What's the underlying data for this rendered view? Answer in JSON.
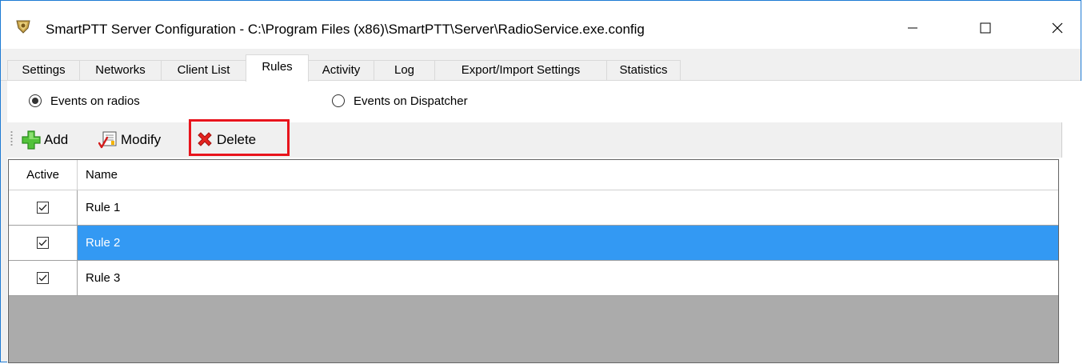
{
  "window": {
    "title": "SmartPTT Server Configuration - C:\\Program Files (x86)\\SmartPTT\\Server\\RadioService.exe.config",
    "controls": {
      "minimize": "—",
      "maximize": "☐",
      "close": "✕"
    }
  },
  "tabs": [
    {
      "label": "Settings",
      "active": false
    },
    {
      "label": "Networks",
      "active": false
    },
    {
      "label": "Client List",
      "active": false
    },
    {
      "label": "Rules",
      "active": true
    },
    {
      "label": "Activity",
      "active": false
    },
    {
      "label": "Log",
      "active": false
    },
    {
      "label": "Export/Import Settings",
      "active": false
    },
    {
      "label": "Statistics",
      "active": false
    }
  ],
  "events": {
    "radios_label": "Events on radios",
    "radios_selected": true,
    "dispatcher_label": "Events on Dispatcher",
    "dispatcher_selected": false
  },
  "toolbar": {
    "add_label": "Add",
    "modify_label": "Modify",
    "delete_label": "Delete",
    "icons": {
      "add": "green-plus-icon",
      "modify": "edit-list-icon",
      "delete": "red-x-icon"
    },
    "highlight_color": "#e8141c"
  },
  "grid": {
    "columns": [
      "Active",
      "Name"
    ],
    "rows": [
      {
        "active": true,
        "name": "Rule 1",
        "selected": false
      },
      {
        "active": true,
        "name": "Rule 2",
        "selected": true
      },
      {
        "active": true,
        "name": "Rule 3",
        "selected": false
      }
    ],
    "selection_color": "#3399f3",
    "empty_area_color": "#ababab"
  }
}
